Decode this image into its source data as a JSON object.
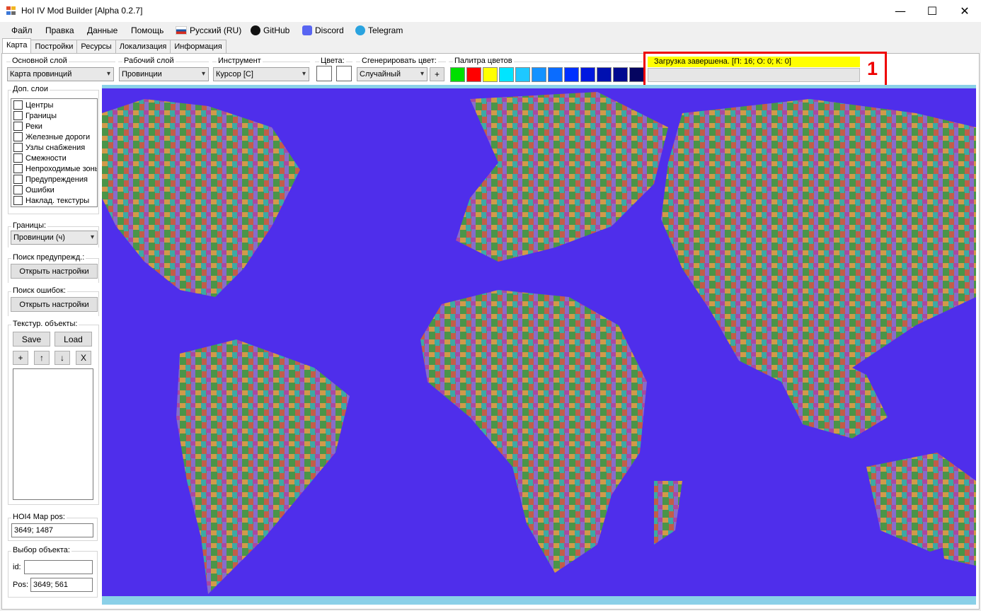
{
  "window": {
    "title": "HoI IV Mod Builder [Alpha 0.2.7]",
    "minimize": "—",
    "maximize": "☐",
    "close": "✕"
  },
  "menu": {
    "file": "Файл",
    "edit": "Правка",
    "data": "Данные",
    "help": "Помощь",
    "language": "Русский (RU)",
    "github": "GitHub",
    "discord": "Discord",
    "telegram": "Telegram"
  },
  "tabs": [
    "Карта",
    "Постройки",
    "Ресурсы",
    "Локализация",
    "Информация"
  ],
  "toolbar": {
    "main_layer_label": "Основной слой",
    "main_layer_value": "Карта провинций",
    "work_layer_label": "Рабочий слой",
    "work_layer_value": "Провинции",
    "tool_label": "Инструмент",
    "tool_value": "Курсор [C]",
    "colors_label": "Цвета:",
    "generate_label": "Сгенерировать цвет:",
    "generate_value": "Случайный",
    "generate_add": "+",
    "palette_label": "Палитра цветов",
    "palette": [
      "#00e000",
      "#ff0000",
      "#ffff00",
      "#00e5ff",
      "#1ec8ff",
      "#1492ff",
      "#0a6cff",
      "#0030ff",
      "#0018e0",
      "#0010b0",
      "#000a90",
      "#050560"
    ]
  },
  "status": {
    "text": "Загрузка завершена. [П: 16; О: 0; К: 0]",
    "highlight_number": "1"
  },
  "sidebar": {
    "extra_layers_label": "Доп. слои",
    "extra_layers": [
      "Центры",
      "Границы",
      "Реки",
      "Железные дороги",
      "Узлы снабжения",
      "Смежности",
      "Непроходимые зоны",
      "Предупреждения",
      "Ошибки",
      "Наклад. текстуры"
    ],
    "borders_label": "Границы:",
    "borders_value": "Провинции (ч)",
    "warnings_label": "Поиск предупрежд.:",
    "warnings_button": "Открыть настройки",
    "errors_label": "Поиск ошибок:",
    "errors_button": "Открыть настройки",
    "texture_label": "Текстур. объекты:",
    "save": "Save",
    "load": "Load",
    "add": "+",
    "up": "↑",
    "down": "↓",
    "remove": "X",
    "map_pos_label": "HOI4 Map pos:",
    "map_pos_value": "3649; 1487",
    "select_label": "Выбор объекта:",
    "id_label": "id:",
    "id_value": "",
    "pos_label": "Pos:",
    "pos_value": "3649; 561"
  }
}
